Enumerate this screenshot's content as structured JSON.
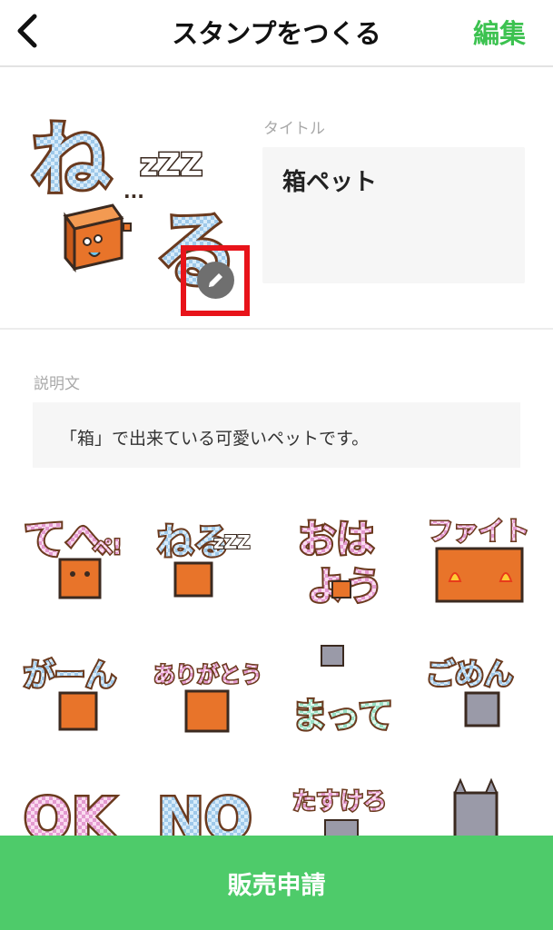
{
  "header": {
    "title": "スタンプをつくる",
    "edit_label": "編集",
    "back_icon": "chevron-left-icon"
  },
  "main_sticker": {
    "text_top": "ね",
    "text_zzz": "zZZ",
    "text_bottom": "る"
  },
  "title_field": {
    "label": "タイトル",
    "value": "箱ペット"
  },
  "description_field": {
    "label": "説明文",
    "value": "「箱」で出来ている可愛いペットです。"
  },
  "stickers": [
    {
      "text": "てへ",
      "extra": "ペ!"
    },
    {
      "text": "ねる",
      "extra": "zZZ"
    },
    {
      "text": "おは",
      "extra": "よう"
    },
    {
      "text": "ファイト",
      "extra": ""
    },
    {
      "text": "がーん",
      "extra": ""
    },
    {
      "text": "ありがとう",
      "extra": ""
    },
    {
      "text": "まって",
      "extra": ""
    },
    {
      "text": "ごめん",
      "extra": ""
    },
    {
      "text": "OK",
      "extra": ""
    },
    {
      "text": "NO",
      "extra": ""
    },
    {
      "text": "たすけろ",
      "extra": ""
    },
    {
      "text": "",
      "extra": ""
    }
  ],
  "submit": {
    "label": "販売申請"
  },
  "colors": {
    "accent_green": "#3cc250",
    "button_green": "#4ecb6a",
    "highlight_red": "#e8131a",
    "box_orange": "#e8742a",
    "pink_text": "#e88ac8",
    "blue_text": "#a9cce8",
    "mint_text": "#9fe6c8"
  }
}
